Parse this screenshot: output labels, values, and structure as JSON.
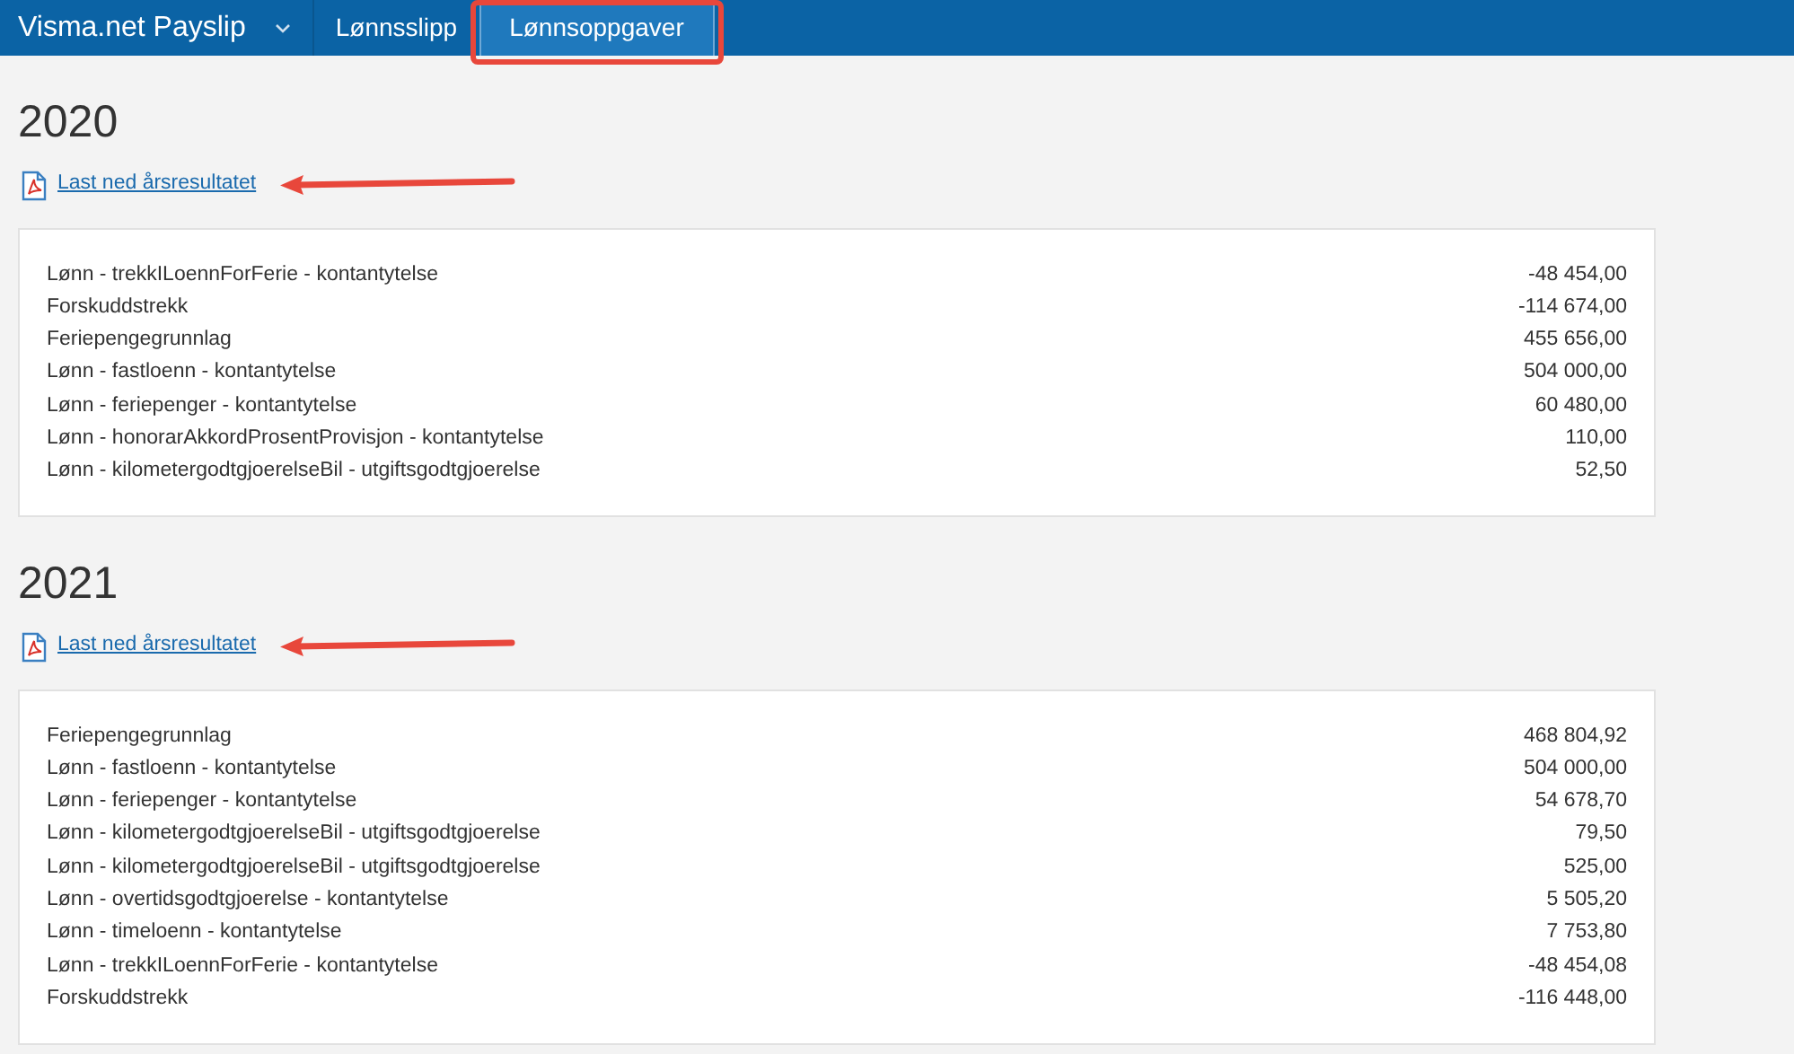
{
  "app": {
    "title": "Visma.net Payslip"
  },
  "tabs": [
    {
      "label": "Lønnsslipp",
      "selected": false,
      "annotated": false
    },
    {
      "label": "Lønnsoppgaver",
      "selected": true,
      "annotated": true
    }
  ],
  "years": [
    {
      "year": "2020",
      "download_link": "Last ned årsresultatet",
      "arrow": true,
      "rows": [
        {
          "label": "Lønn - trekkILoennForFerie - kontantytelse",
          "amount": "-48 454,00"
        },
        {
          "label": "Forskuddstrekk",
          "amount": "-114 674,00"
        },
        {
          "label": "Feriepengegrunnlag",
          "amount": "455 656,00"
        },
        {
          "label": "Lønn - fastloenn - kontantytelse",
          "amount": "504 000,00"
        },
        {
          "label": "Lønn - feriepenger - kontantytelse",
          "amount": "60 480,00"
        },
        {
          "label": "Lønn - honorarAkkordProsentProvisjon - kontantytelse",
          "amount": "110,00"
        },
        {
          "label": "Lønn - kilometergodtgjoerelseBil - utgiftsgodtgjoerelse",
          "amount": "52,50"
        }
      ]
    },
    {
      "year": "2021",
      "download_link": "Last ned årsresultatet",
      "arrow": true,
      "rows": [
        {
          "label": "Feriepengegrunnlag",
          "amount": "468 804,92"
        },
        {
          "label": "Lønn - fastloenn - kontantytelse",
          "amount": "504 000,00"
        },
        {
          "label": "Lønn - feriepenger - kontantytelse",
          "amount": "54 678,70"
        },
        {
          "label": "Lønn - kilometergodtgjoerelseBil - utgiftsgodtgjoerelse",
          "amount": "79,50"
        },
        {
          "label": "Lønn - kilometergodtgjoerelseBil - utgiftsgodtgjoerelse",
          "amount": "525,00"
        },
        {
          "label": "Lønn - overtidsgodtgjoerelse - kontantytelse",
          "amount": "5 505,20"
        },
        {
          "label": "Lønn - timeloenn - kontantytelse",
          "amount": "7 753,80"
        },
        {
          "label": "Lønn - trekkILoennForFerie - kontantytelse",
          "amount": "-48 454,08"
        },
        {
          "label": "Forskuddstrekk",
          "amount": "-116 448,00"
        }
      ]
    }
  ]
}
